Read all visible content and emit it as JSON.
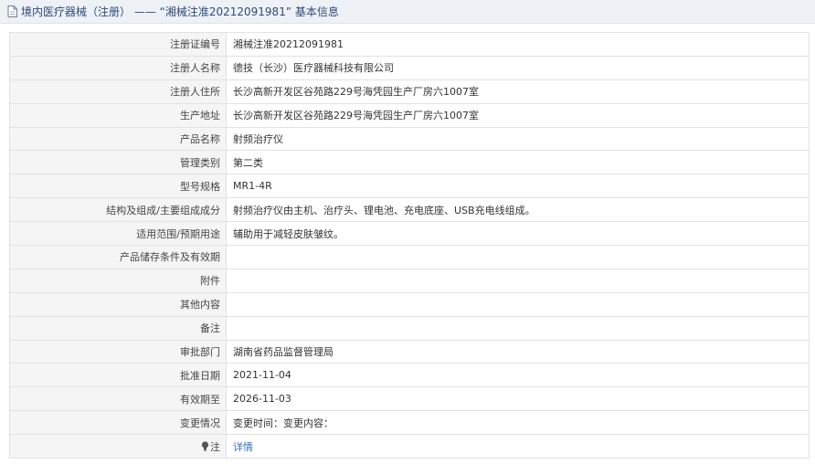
{
  "header": {
    "title": "境内医疗器械（注册） —— “湘械注准20212091981” 基本信息",
    "icon": "document-icon"
  },
  "rows": [
    {
      "label": "注册证编号",
      "value": "湘械注准20212091981"
    },
    {
      "label": "注册人名称",
      "value": "德技（长沙）医疗器械科技有限公司"
    },
    {
      "label": "注册人住所",
      "value": "长沙高新开发区谷苑路229号海凭园生产厂房六1007室"
    },
    {
      "label": "生产地址",
      "value": "长沙高新开发区谷苑路229号海凭园生产厂房六1007室"
    },
    {
      "label": "产品名称",
      "value": "射频治疗仪"
    },
    {
      "label": "管理类别",
      "value": "第二类"
    },
    {
      "label": "型号规格",
      "value": "MR1-4R"
    },
    {
      "label": "结构及组成/主要组成成分",
      "value": "射频治疗仪由主机、治疗头、锂电池、充电底座、USB充电线组成。"
    },
    {
      "label": "适用范围/预期用途",
      "value": "辅助用于减轻皮肤皱纹。"
    },
    {
      "label": "产品储存条件及有效期",
      "value": ""
    },
    {
      "label": "附件",
      "value": ""
    },
    {
      "label": "其他内容",
      "value": ""
    },
    {
      "label": "备注",
      "value": ""
    },
    {
      "label": "审批部门",
      "value": "湖南省药品监督管理局"
    },
    {
      "label": "批准日期",
      "value": "2021-11-04"
    },
    {
      "label": "有效期至",
      "value": "2026-11-03"
    },
    {
      "label": "变更情况",
      "value": "变更时间：变更内容："
    }
  ],
  "note_row": {
    "label": "注",
    "link_text": "详情",
    "icon": "lightbulb-icon"
  },
  "colors": {
    "header_bg": "#eef1f5",
    "header_text": "#2d4a78",
    "label_bg": "#f5f5f5",
    "border": "#e2e2e2",
    "link": "#2f6fc6"
  }
}
